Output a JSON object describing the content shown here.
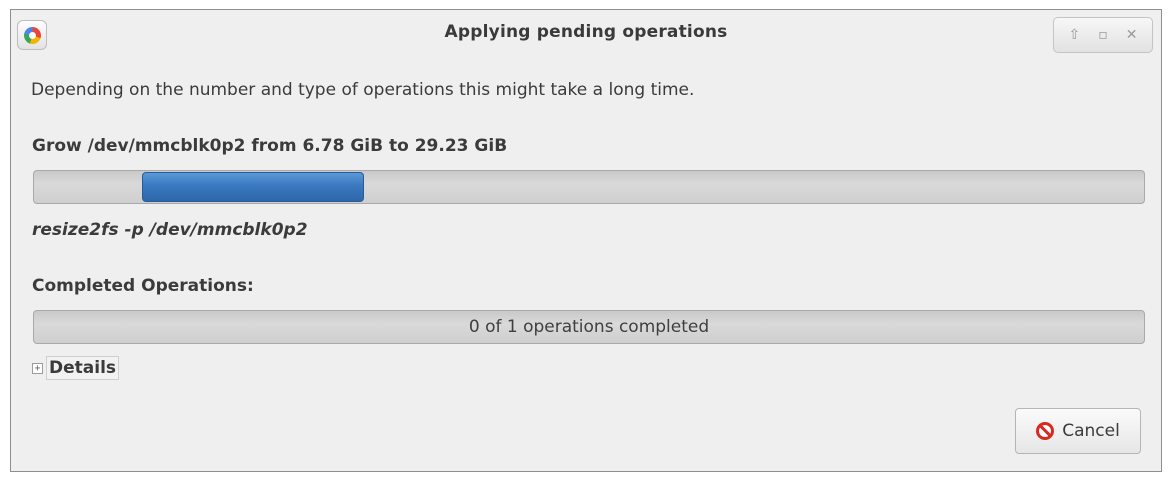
{
  "window": {
    "title": "Applying pending operations",
    "controls": {
      "restore_icon": "⇧",
      "maximize_icon": "▫",
      "close_icon": "✕"
    }
  },
  "content": {
    "description": "Depending on the number and type of operations this might take a long time.",
    "current_operation": "Grow /dev/mmcblk0p2 from 6.78 GiB to 29.23 GiB",
    "current_command": "resize2fs -p /dev/mmcblk0p2",
    "completed_label": "Completed Operations:",
    "completed_progress_text": "0 of 1 operations completed",
    "completed_progress_fraction": 0,
    "details_expander": "+",
    "details_label": "Details"
  },
  "buttons": {
    "cancel_label": "Cancel"
  },
  "colors": {
    "accent_progress": "#3a78c0",
    "cancel_icon": "#d9291e"
  }
}
